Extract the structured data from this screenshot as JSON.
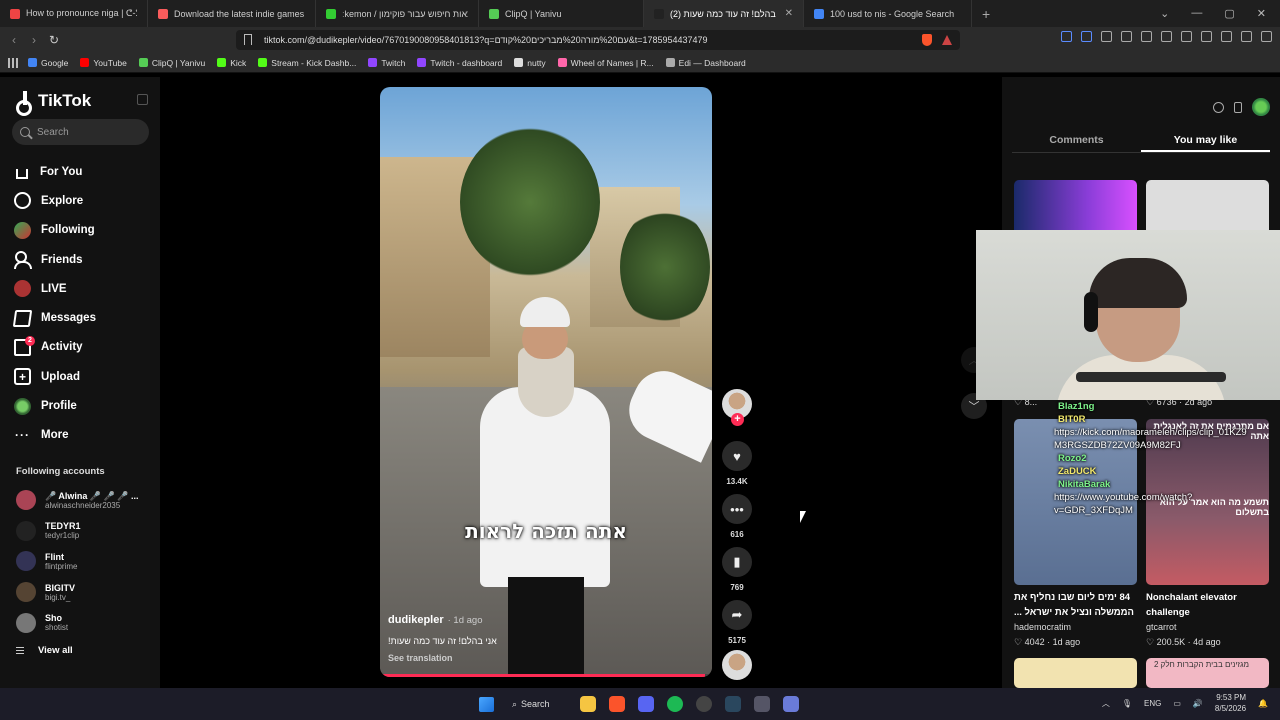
{
  "browser": {
    "tabs": [
      {
        "title": "How to pronounce niga | ᕦ-ᕤ? (you n",
        "color": "#e44"
      },
      {
        "title": "Download the latest indie games - it",
        "color": "#fa5c5c"
      },
      {
        "title": "ːkemon / תוצאות חיפוש עבור פוקימון",
        "color": "#3c3"
      },
      {
        "title": "ClipQ | Yanivu",
        "color": "#5c5"
      },
      {
        "title": "(2) אני בהלם! זה עוד כמה שעות! |",
        "color": "#222",
        "active": true
      },
      {
        "title": "100 usd to nis - Google Search",
        "color": "#4285f4"
      }
    ],
    "new_tab": "+",
    "url": "tiktok.com/@dudikepler/video/7670190080958401813?q=עם%20מורה%20מבריכים%20קודם&t=1785954437479",
    "bookmarks": [
      {
        "label": "Google",
        "color": "#4285f4"
      },
      {
        "label": "YouTube",
        "color": "#f00"
      },
      {
        "label": "ClipQ | Yanivu",
        "color": "#5c5"
      },
      {
        "label": "Kick",
        "color": "#53fc18"
      },
      {
        "label": "Stream - Kick Dashb...",
        "color": "#53fc18"
      },
      {
        "label": "Twitch",
        "color": "#9146ff"
      },
      {
        "label": "Twitch - dashboard",
        "color": "#9146ff"
      },
      {
        "label": "nutty",
        "color": "#ddd"
      },
      {
        "label": "Wheel of Names | R...",
        "color": "#f6a"
      },
      {
        "label": "Edi — Dashboard",
        "color": "#aaa"
      }
    ]
  },
  "sidebar": {
    "brand": "TikTok",
    "search_placeholder": "Search",
    "nav": [
      {
        "label": "For You",
        "icon": "home-icon"
      },
      {
        "label": "Explore",
        "icon": "compass-icon"
      },
      {
        "label": "Following",
        "icon": "following-icon"
      },
      {
        "label": "Friends",
        "icon": "friends-icon"
      },
      {
        "label": "LIVE",
        "icon": "live-icon"
      },
      {
        "label": "Messages",
        "icon": "messages-icon"
      },
      {
        "label": "Activity",
        "icon": "activity-icon",
        "badge": "2"
      },
      {
        "label": "Upload",
        "icon": "upload-icon"
      },
      {
        "label": "Profile",
        "icon": "profile-icon"
      },
      {
        "label": "More",
        "icon": "more-icon"
      }
    ],
    "following_heading": "Following accounts",
    "accounts": [
      {
        "name": "🎤 Alwina 🎤 🎤 🎤 ...",
        "handle": "alwinaschneider2035",
        "color": "#a45"
      },
      {
        "name": "TEDYR1",
        "handle": "tedyr1clip",
        "color": "#222"
      },
      {
        "name": "Flint",
        "handle": "flintprime",
        "color": "#335"
      },
      {
        "name": "BIGITV",
        "handle": "bigi.tv_",
        "color": "#543"
      },
      {
        "name": "Sho",
        "handle": "shotist",
        "color": "#777"
      }
    ],
    "view_all": "View all"
  },
  "video": {
    "caption": "אתה תזכה לראות",
    "author": "dudikepler",
    "age": "· 1d ago",
    "description": "אני בהלם! זה עוד כמה שעות!",
    "see_translation": "See translation",
    "progress": 0.98
  },
  "actions": {
    "likes": "13.4K",
    "comments": "616",
    "saves": "769",
    "shares": "5175",
    "follow_plus": "+"
  },
  "right_panel": {
    "tabs": [
      "Comments",
      "You may like"
    ],
    "active_tab": "You may like",
    "cards": [
      {
        "title": "84 ימים ליום שבו נחליף את הממשלה ונציל את ישראל ...",
        "author": "hademocratim",
        "likes": "4042",
        "age": "1d ago"
      },
      {
        "title": "Nonchalant elevator challenge",
        "author": "gtcarrot",
        "likes": "200.5K",
        "age": "4d ago"
      }
    ],
    "partial_meta_left": "♡ 8...",
    "partial_meta_right": "♡ 6736 · 2d ago",
    "thumb_text_right": "אם מתרגמים את זה לאנגלית אתה",
    "thumb_text_right2": "תשמע מה הוא אמר על הוא בתשלום",
    "thumb_bottom_right": "מגזינים בבית הקברות חלק 2"
  },
  "chat_overlay": [
    {
      "user": "Blaz1ng",
      "text": ""
    },
    {
      "user": "BIT0R",
      "text": ""
    },
    {
      "user": "",
      "text": "https://kick.com/maorameleh/clips/clip_01KZ9"
    },
    {
      "user": "",
      "text": "M3RGSZDB72ZV09A9M82FJ"
    },
    {
      "user": "Rozo2",
      "text": ""
    },
    {
      "user": "ZaDUCK",
      "text": ""
    },
    {
      "user": "NikitaBarak",
      "text": ""
    },
    {
      "user": "",
      "text": "https://www.youtube.com/watch?"
    },
    {
      "user": "",
      "text": "v=GDR_3XFDqJM"
    }
  ],
  "taskbar": {
    "search": "Search",
    "lang": "ENG",
    "time": "9:53 PM",
    "date": "8/5/2026"
  }
}
